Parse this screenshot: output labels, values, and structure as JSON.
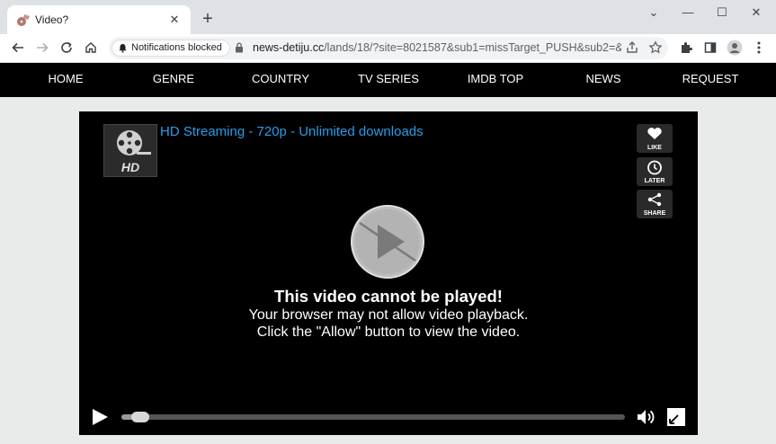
{
  "browser": {
    "tab": {
      "title": "Video?",
      "close_glyph": "✕"
    },
    "new_tab_glyph": "+",
    "window_controls": [
      "⌄",
      "—",
      "☐",
      "✕"
    ],
    "notification_chip": "Notifications blocked",
    "url": {
      "host": "news-detiju.cc",
      "path": "/lands/18/?site=8021587&sub1=missTarget_PUSH&sub2=&..."
    }
  },
  "site": {
    "nav": [
      "HOME",
      "GENRE",
      "COUNTRY",
      "TV SERIES",
      "IMDB TOP",
      "NEWS",
      "REQUEST"
    ]
  },
  "player": {
    "title": "HD Streaming - 720p - Unlimited downloads",
    "thumb_label": "HD",
    "side_buttons": {
      "like": "LIKE",
      "later": "LATER",
      "share": "SHARE"
    },
    "message": {
      "heading": "This video cannot be played!",
      "line1": "Your browser may not allow video playback.",
      "line2": "Click the \"Allow\" button to view the video."
    },
    "progress": 0.02
  },
  "colors": {
    "title_link": "#2a9de8",
    "nav_bg": "#000000",
    "chrome_bg": "#dee1e6"
  }
}
